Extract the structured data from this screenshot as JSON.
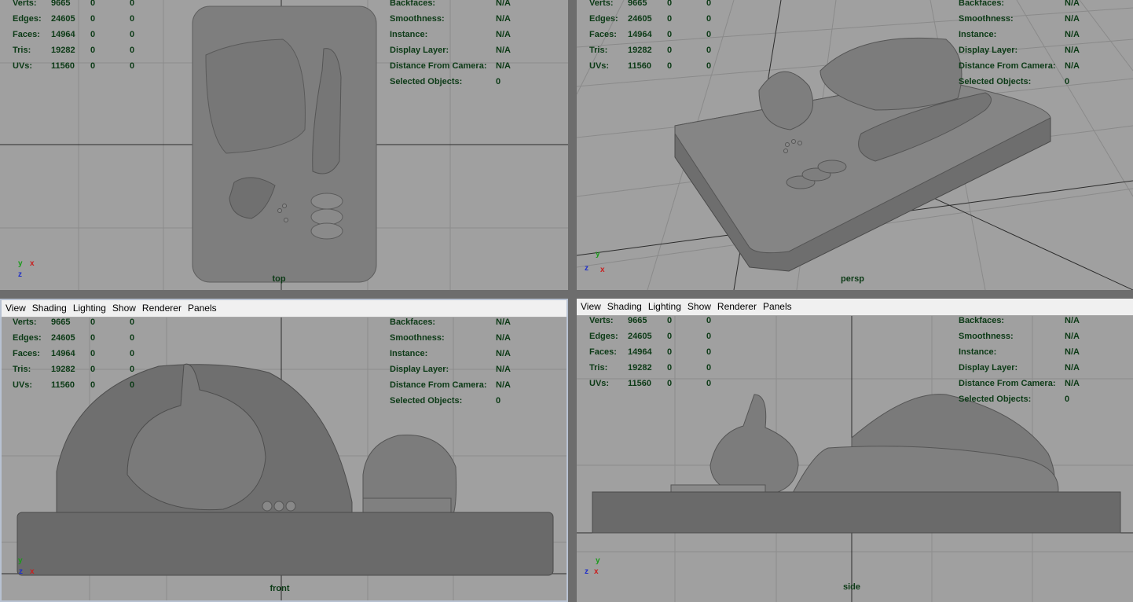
{
  "menu": [
    "View",
    "Shading",
    "Lighting",
    "Show",
    "Renderer",
    "Panels"
  ],
  "hud_left": [
    {
      "label": "Verts:",
      "v1": "9665",
      "v2": "0",
      "v3": "0"
    },
    {
      "label": "Edges:",
      "v1": "24605",
      "v2": "0",
      "v3": "0"
    },
    {
      "label": "Faces:",
      "v1": "14964",
      "v2": "0",
      "v3": "0"
    },
    {
      "label": "Tris:",
      "v1": "19282",
      "v2": "0",
      "v3": "0"
    },
    {
      "label": "UVs:",
      "v1": "11560",
      "v2": "0",
      "v3": "0"
    }
  ],
  "hud_right": [
    {
      "label": "Backfaces:",
      "value": "N/A"
    },
    {
      "label": "Smoothness:",
      "value": "N/A"
    },
    {
      "label": "Instance:",
      "value": "N/A"
    },
    {
      "label": "Display Layer:",
      "value": "N/A"
    },
    {
      "label": "Distance From Camera:",
      "value": "N/A"
    },
    {
      "label": "Selected Objects:",
      "value": "0"
    }
  ],
  "panes": {
    "top": {
      "camera": "top",
      "axis_a": "y",
      "axis_b": "x",
      "axis_c": "z"
    },
    "persp": {
      "camera": "persp",
      "axis_a": "y",
      "axis_b": "z",
      "axis_c": "x"
    },
    "front": {
      "camera": "front",
      "axis_a": "y",
      "axis_b": "z",
      "axis_c": "x"
    },
    "side": {
      "camera": "side",
      "axis_a": "y",
      "axis_b": "z",
      "axis_c": "x"
    }
  },
  "colors": {
    "hud_text": "#0c3a16",
    "viewport_bg": "#a0a0a0",
    "grid": "#8a8a8a",
    "grid_axis": "#2a2a2a",
    "selected_pane_border": "#b8c2d2"
  }
}
